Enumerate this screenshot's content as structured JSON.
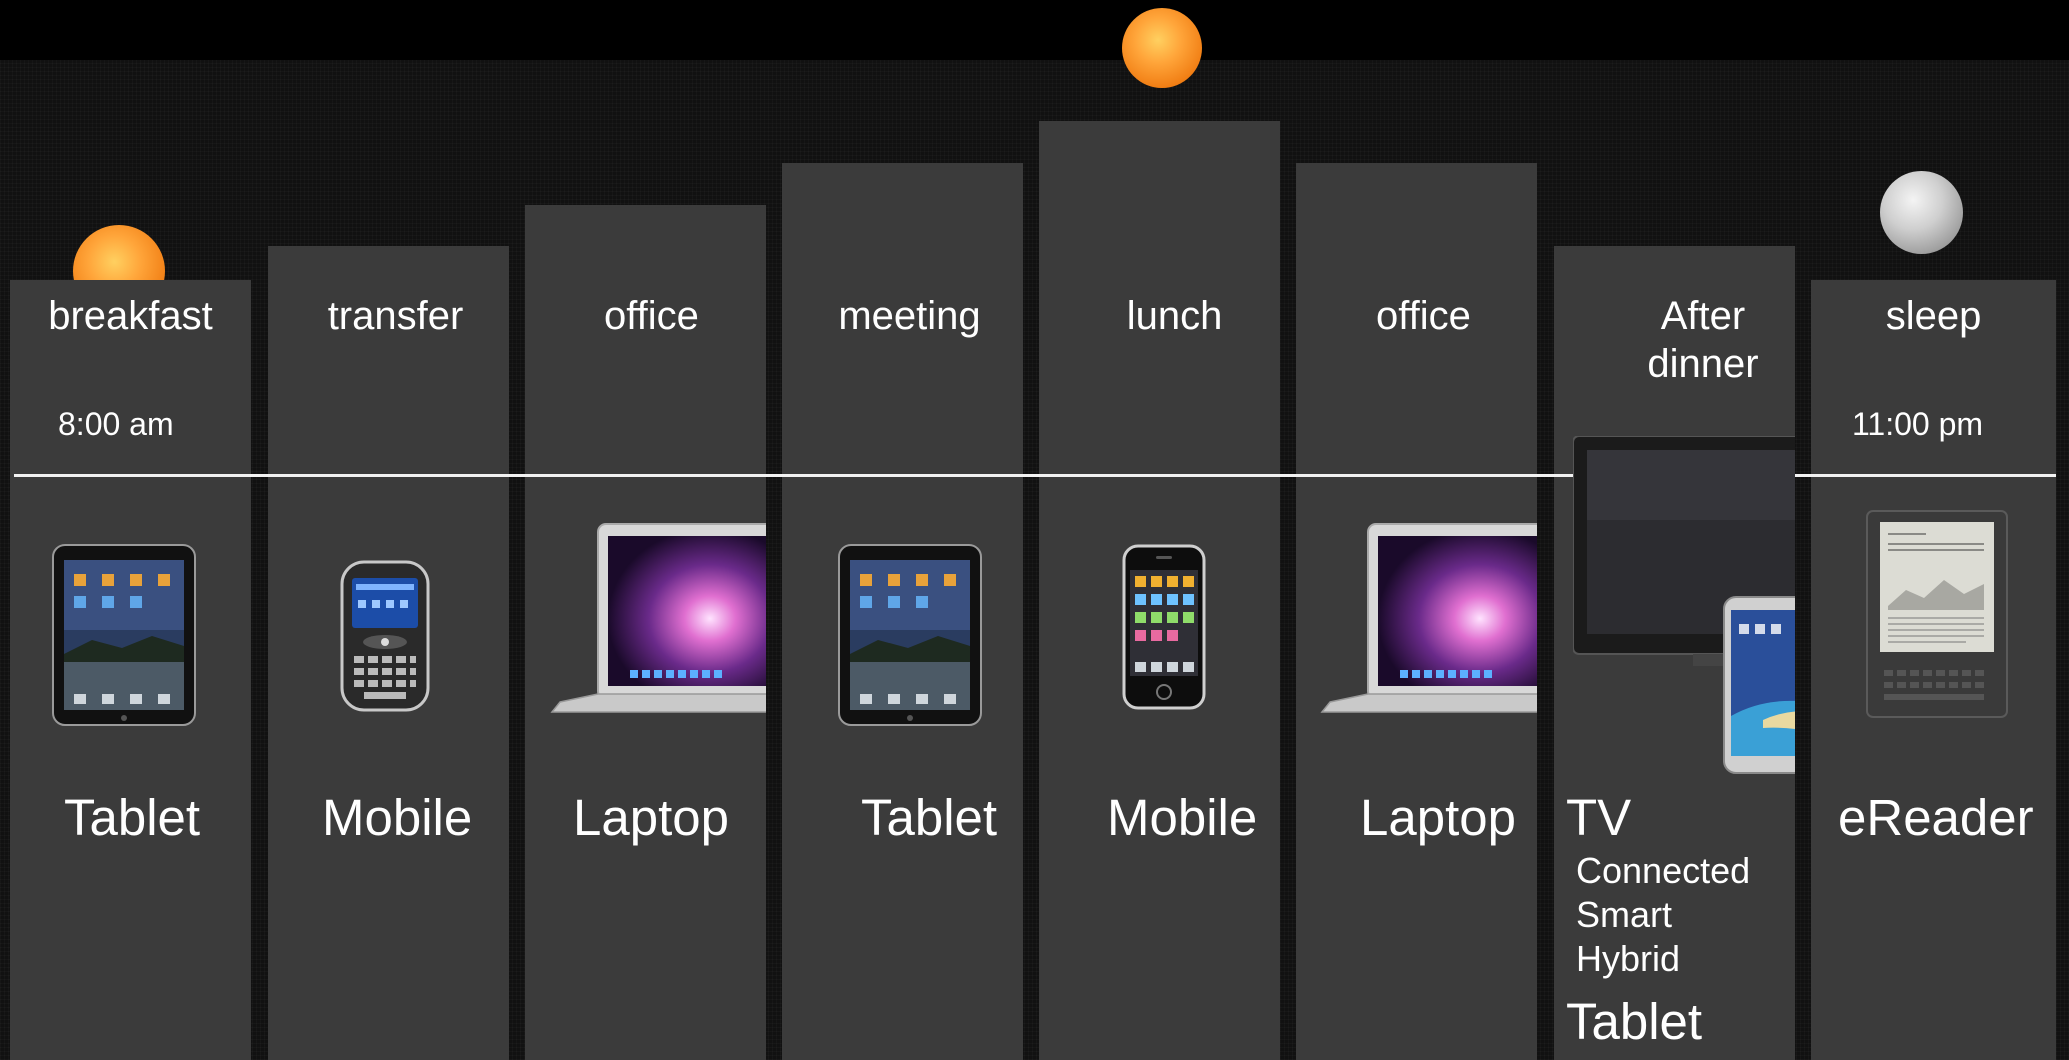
{
  "columns": [
    {
      "label": "breakfast",
      "time": "8:00 am",
      "device": "Tablet"
    },
    {
      "label": "transfer",
      "device": "Mobile"
    },
    {
      "label": "office",
      "device": "Laptop"
    },
    {
      "label": "meeting",
      "device": "Tablet"
    },
    {
      "label": "lunch",
      "device": "Mobile"
    },
    {
      "label": "office",
      "device": "Laptop"
    },
    {
      "label_line1": "After",
      "label_line2": "dinner",
      "device": "TV",
      "sub_items": [
        "Connected",
        "Smart",
        "Hybrid"
      ],
      "extra_device": "Tablet"
    },
    {
      "label": "sleep",
      "time": "11:00 pm",
      "device": "eReader"
    }
  ],
  "icons": [
    "sunrise-icon",
    "midday-sun-icon",
    "moon-icon",
    "tablet-icon",
    "smartphone-icon",
    "laptop-icon",
    "iphone-icon",
    "tv-icon",
    "ereader-icon"
  ],
  "colors": {
    "background": "#000000",
    "column": "#3b3b3b",
    "text": "#ffffff",
    "sun": "#f28a1e",
    "timeline": "#f2f2f2"
  }
}
